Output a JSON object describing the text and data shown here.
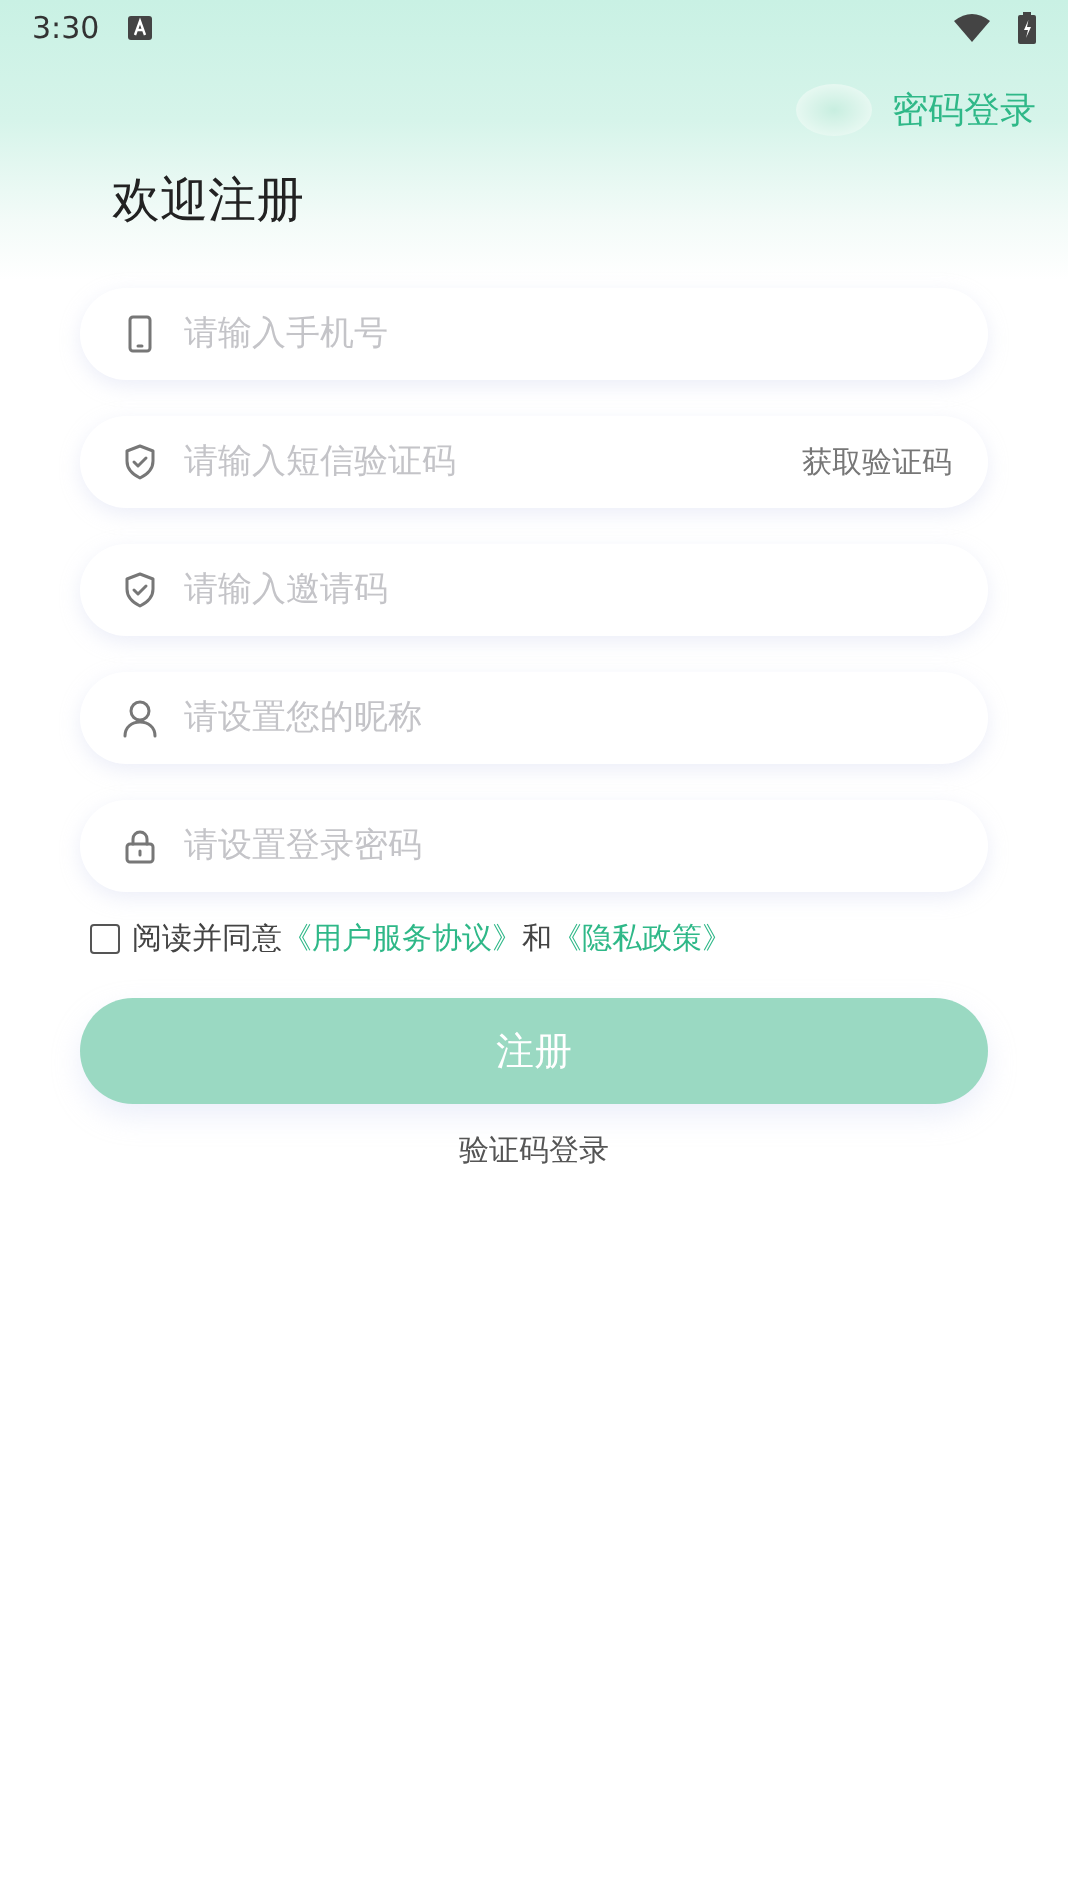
{
  "status_bar": {
    "time": "3:30"
  },
  "top_link": "密码登录",
  "title": "欢迎注册",
  "fields": [
    {
      "kind": "phone",
      "placeholder": "请输入手机号"
    },
    {
      "kind": "shield",
      "placeholder": "请输入短信验证码",
      "action": "获取验证码"
    },
    {
      "kind": "shield",
      "placeholder": "请输入邀请码"
    },
    {
      "kind": "user",
      "placeholder": "请设置您的昵称"
    },
    {
      "kind": "lock",
      "placeholder": "请设置登录密码"
    }
  ],
  "agreement": {
    "checked": false,
    "text": "阅读并同意",
    "link_1": "《用户服务协议》",
    "joiner": "和",
    "link_2": "《隐私政策》"
  },
  "submit": {
    "label": "注册",
    "disabled": true
  },
  "alt_login": "验证码登录"
}
